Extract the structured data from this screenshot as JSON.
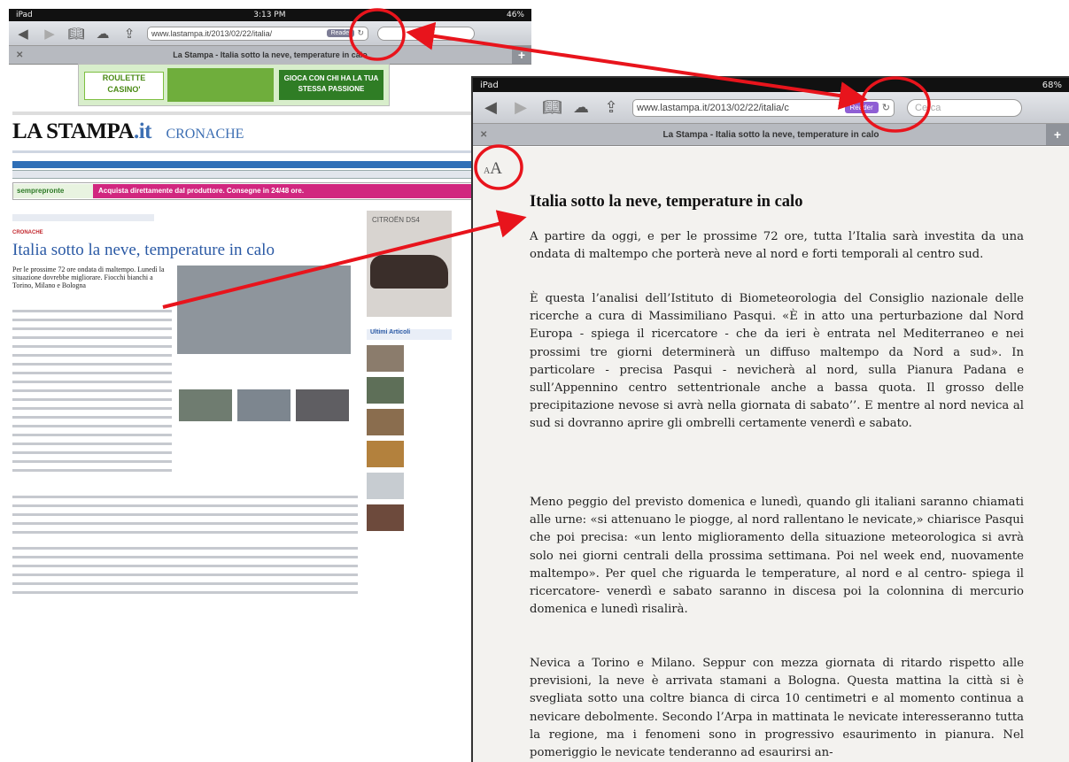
{
  "left": {
    "status": {
      "device": "iPad",
      "time": "3:13 PM",
      "battery": "46%"
    },
    "url": "www.lastampa.it/2013/02/22/italia/",
    "reader_label": "Reader",
    "tab_title": "La Stampa - Italia sotto la neve, temperature in calo",
    "ad": {
      "logo": "ROULETTE CASINO'",
      "text": "GIOCA CON CHI HA LA TUA STESSA PASSIONE"
    },
    "logo": "LA STAMPA",
    "logo_it": ".it",
    "section": "CRONACHE",
    "promo_brand": "semprepronte",
    "promo_text": "Acquista direttamente dal produttore. Consegne in 24/48 ore.",
    "article_section": "CRONACHE",
    "article_title": "Italia sotto la neve, temperature in calo",
    "article_sub": "Per le prossime 72 ore ondata di maltempo. Lunedì la situazione dovrebbe migliorare. Fiocchi bianchi a Torino, Milano e Bologna",
    "side_ad": "CITROËN DS4",
    "ultimi": "Ultimi Articoli"
  },
  "right": {
    "status": {
      "device": "iPad",
      "battery": "68%"
    },
    "url": "www.lastampa.it/2013/02/22/italia/c",
    "reader_label": "Reader",
    "search_placeholder": "Cerca",
    "tab_title": "La Stampa - Italia sotto la neve, temperature in calo",
    "font_toggle_small": "A",
    "font_toggle_big": "A",
    "title": "Italia sotto la neve, temperature in calo",
    "paragraphs": [
      "A partire da oggi, e per le prossime 72 ore, tutta l’Italia sarà investita da una ondata di maltempo che porterà neve al nord e forti temporali al centro sud.",
      "È questa l’analisi dell’Istituto di Biometeorologia del Consiglio nazionale delle ricerche a cura di Massimiliano Pasqui. «È in atto una perturbazione dal Nord Europa - spiega il ricercatore - che da ieri è entrata nel Mediterraneo e nei prossimi tre giorni determinerà un diffuso maltempo da Nord a sud». In particolare - precisa Pasqui - nevicherà al nord, sulla Pianura Padana e sull’Appennino centro settentrionale anche a bassa quota. Il grosso delle precipitazione nevose si avrà nella giornata di sabato’’. E mentre al nord nevica al sud si dovranno aprire gli ombrelli certamente venerdì e sabato.",
      "Meno peggio del previsto domenica e lunedì, quando gli italiani saranno chiamati alle urne: «si attenuano le piogge, al nord rallentano le nevicate,» chiarisce Pasqui che poi precisa: «un lento miglioramento della situazione meteorologica si avrà solo nei giorni centrali della prossima settimana. Poi nel week end, nuovamente maltempo». Per quel che riguarda le temperature, al nord e al centro- spiega il ricercatore- venerdì e sabato saranno in discesa poi la colonnina di mercurio domenica e lunedì risalirà.",
      "Nevica a Torino e Milano. Seppur con mezza giornata di ritardo rispetto alle previsioni, la neve è arrivata stamani a Bologna. Questa mattina la città si è svegliata sotto una coltre bianca di circa 10 centimetri e al momento continua a nevicare debolmente. Secondo l’Arpa in mattinata le nevicate interesseranno tutta la regione, ma i fenomeni sono in progressivo esaurimento in pianura. Nel pomeriggio le nevicate tenderanno ad esaurirsi an-"
    ]
  },
  "annotation_color": "#e8141c"
}
